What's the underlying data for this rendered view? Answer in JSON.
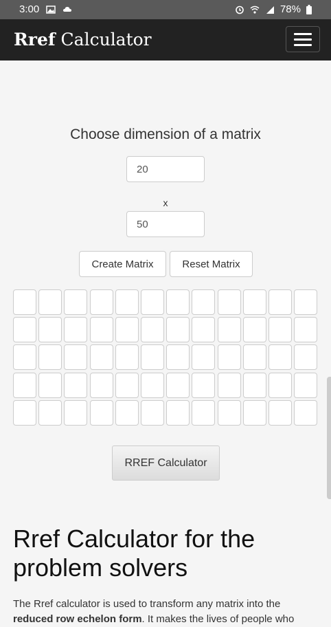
{
  "status_bar": {
    "time": "3:00",
    "battery": "78%",
    "icons": [
      "image-icon",
      "cloud-icon",
      "alarm-icon",
      "wifi-icon",
      "signal-icon",
      "battery-icon"
    ]
  },
  "header": {
    "brand_bold": "Rref",
    "brand_rest": " Calculator",
    "menu_icon": "hamburger-icon"
  },
  "form": {
    "title": "Choose dimension of a matrix",
    "rows_value": "20",
    "separator": "x",
    "cols_value": "50",
    "create_label": "Create Matrix",
    "reset_label": "Reset Matrix"
  },
  "matrix": {
    "visible_rows": 5,
    "visible_cols": 12
  },
  "calc_button": {
    "label": "RREF Calculator"
  },
  "article": {
    "heading": "Rref Calculator for the problem solvers",
    "intro_start": "The Rref calculator is used to transform any matrix into the",
    "intro_bold": "reduced row echelon form",
    "intro_rest": ". It makes the lives of people who"
  },
  "colors": {
    "header_bg": "#222222",
    "status_bg": "#5a5a5a",
    "page_bg": "#f5f5f5"
  }
}
